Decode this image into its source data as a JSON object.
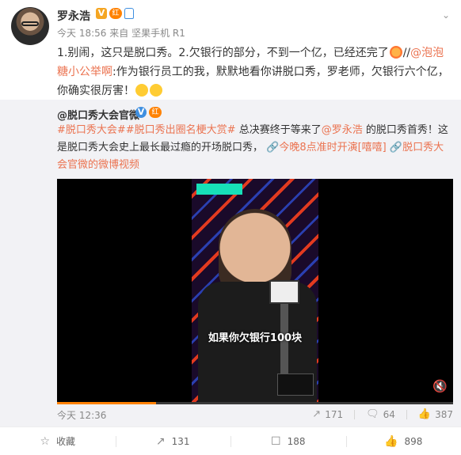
{
  "post": {
    "author": "罗永浩",
    "author_badges": [
      "v-badge",
      "red-badge",
      "bottle-badge"
    ],
    "time": "今天 18:56",
    "source_label": "来自",
    "source": "坚果手机 R1",
    "text_parts": {
      "p1": "1.别闹，这只是脱口秀。2.欠银行的部分，不到一个亿，已经还完了",
      "p2": "//",
      "mention": "@泡泡糖小公举啊",
      "p3": ":作为银行员工的我，默默地看你讲脱口秀，罗老师，欠银行六个亿，你确实很厉害！"
    }
  },
  "repost": {
    "author": "@脱口秀大会官微",
    "tags": "#脱口秀大会##脱口秀出圈名梗大赏#",
    "text1": " 总决赛终于等来了",
    "mention": "@罗永浩",
    "text2": " 的脱口秀首秀！这是脱口秀大会史上最长最过瘾的开场脱口秀，",
    "link1": "今晚8点准时开演[嘻嘻]",
    "link2": "脱口秀大会官微的微博视频",
    "video": {
      "subtitle": "如果你欠银行100块",
      "progress": 0.25
    },
    "time": "今天 12:36",
    "reposts": "171",
    "comments": "64",
    "likes": "387"
  },
  "actions": {
    "favorite": "收藏",
    "repost": "131",
    "comment": "188",
    "like": "898"
  },
  "colors": {
    "link": "#eb7350",
    "accent": "#ff8200",
    "verified_blue": "#3f8fe0"
  }
}
